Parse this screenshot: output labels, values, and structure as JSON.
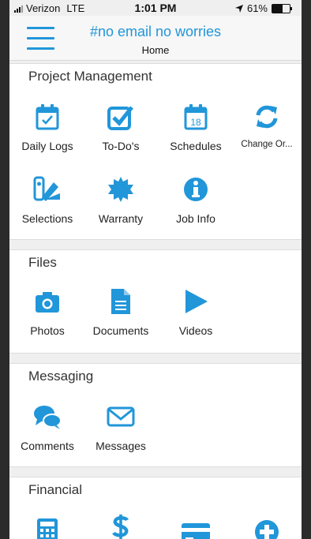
{
  "status": {
    "carrier": "Verizon",
    "network": "LTE",
    "time": "1:01 PM",
    "battery": "61%",
    "battery_level": 0.61
  },
  "header": {
    "title": "#no email no worries",
    "subtitle": "Home"
  },
  "sections": {
    "project_management": {
      "title": "Project Management",
      "items": {
        "daily_logs": "Daily Logs",
        "todos": "To-Do's",
        "schedules": "Schedules",
        "change_orders": "Change Or...",
        "selections": "Selections",
        "warranty": "Warranty",
        "job_info": "Job Info"
      },
      "calendar_day": "18"
    },
    "files": {
      "title": "Files",
      "items": {
        "photos": "Photos",
        "documents": "Documents",
        "videos": "Videos"
      }
    },
    "messaging": {
      "title": "Messaging",
      "items": {
        "comments": "Comments",
        "messages": "Messages"
      }
    },
    "financial": {
      "title": "Financial"
    }
  },
  "colors": {
    "accent": "#2196d9",
    "text": "#222222",
    "divider": "#efefef"
  }
}
